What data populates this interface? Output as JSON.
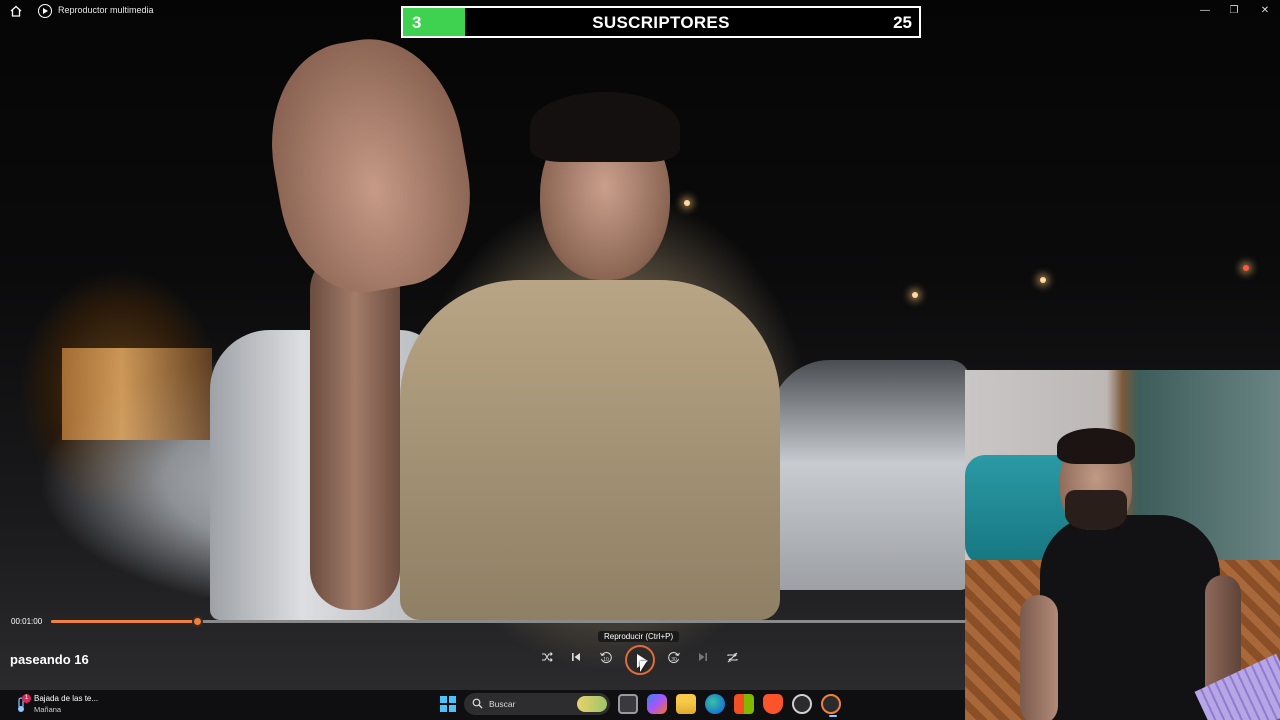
{
  "window": {
    "app_title": "Reproductor multimedia",
    "minimize_glyph": "—",
    "maximize_glyph": "❐",
    "close_glyph": "✕"
  },
  "overlay": {
    "subscriber_count": "3",
    "label": "SUSCRIPTORES",
    "goal": "25",
    "progress_fraction": 0.12,
    "fill_color": "#3fd150"
  },
  "player": {
    "current_time": "00:01:00",
    "seek_fraction": 0.16,
    "accent_color": "#f0813c",
    "media_title": "paseando 16",
    "play_tooltip": "Reproducir (Ctrl+P)",
    "controls": {
      "shuffle_icon": "shuffle-icon",
      "previous_icon": "previous-icon",
      "rewind_icon": "rewind-10-icon",
      "rewind_label": "10",
      "play_icon": "play-icon",
      "forward_icon": "forward-30-icon",
      "forward_label": "30",
      "next_icon": "next-icon",
      "repeat_icon": "repeat-off-icon"
    }
  },
  "taskbar": {
    "weather_title": "Bajada de las te...",
    "weather_subtitle": "Mañana",
    "weather_badge": "1",
    "search_placeholder": "Buscar",
    "apps": [
      "start-icon",
      "task-view-icon",
      "copilot-icon",
      "file-explorer-icon",
      "edge-icon",
      "store-icon",
      "brave-icon",
      "chatgpt-icon",
      "media-player-icon"
    ]
  }
}
